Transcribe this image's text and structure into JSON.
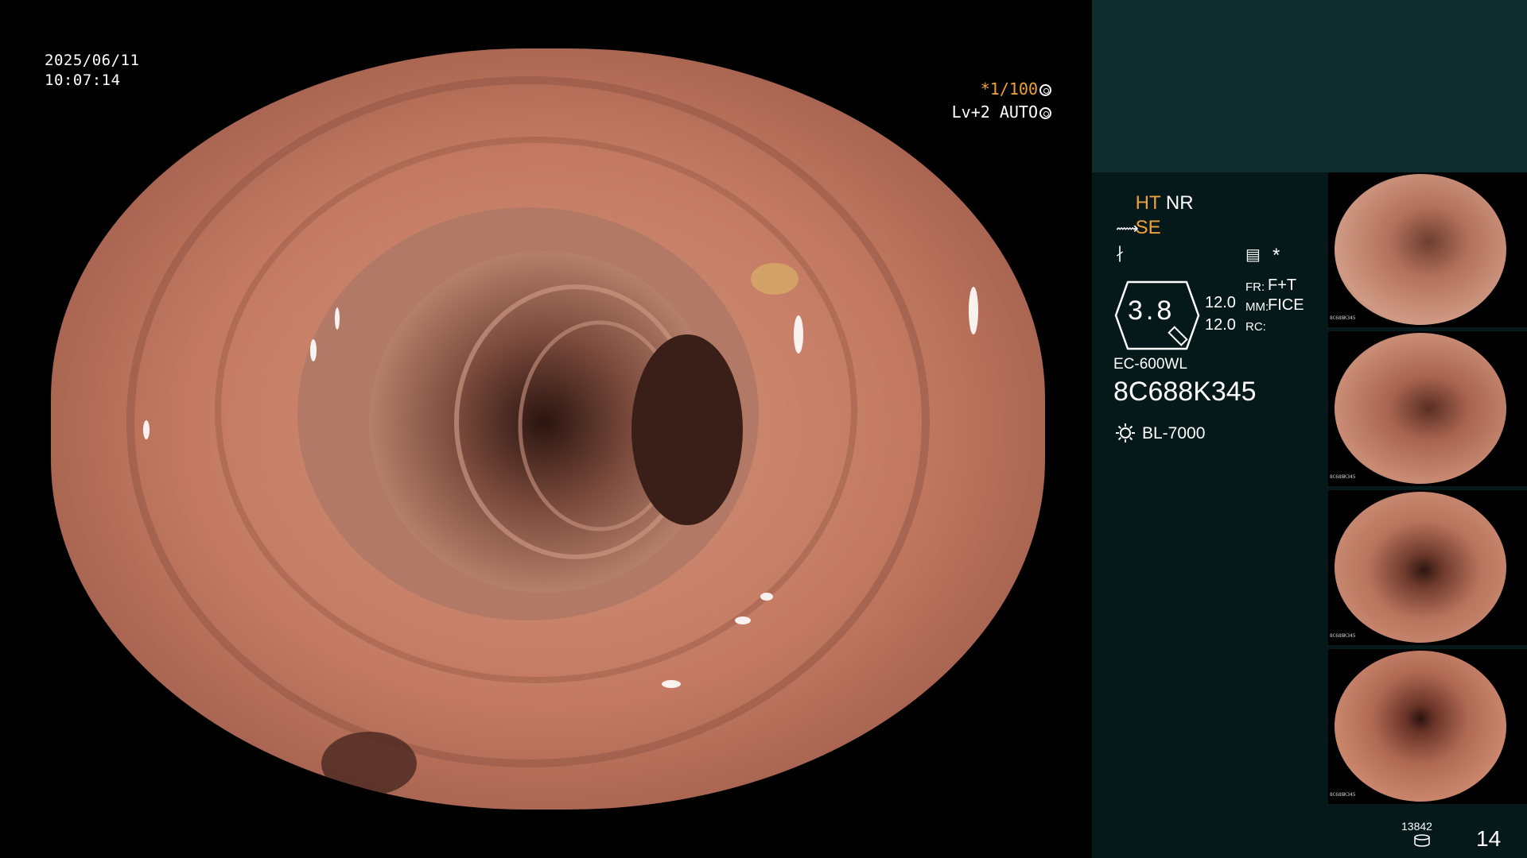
{
  "overlay": {
    "date": "2025/06/11",
    "time": "10:07:14",
    "shutter": "*1/100",
    "level": "Lv+2 AUTO"
  },
  "processing": {
    "ht": "HT",
    "nr": "NR",
    "se": "SE",
    "prc_value": "3.8",
    "gain_top": "12.0",
    "gain_bottom": "12.0",
    "fr_label": "FR:",
    "fr_value": "F+T",
    "mm_label": "MM:",
    "mm_value": "FICE",
    "rc_label": "RC:",
    "asterisk": "*"
  },
  "scope": {
    "model": "EC-600WL",
    "serial": "8C688K345",
    "light_source": "BL-7000"
  },
  "thumbnails": [
    {
      "label": "8C688K345"
    },
    {
      "label": "8C688K345"
    },
    {
      "label": "8C688K345"
    },
    {
      "label": "8C688K345"
    }
  ],
  "footer": {
    "image_count": "13842",
    "page": "14"
  },
  "colors": {
    "accent_orange": "#f0a23a",
    "sidebar_bg": "#06191a",
    "sidebar_top": "#0e2d2d",
    "mucosa": "#c97a62"
  }
}
